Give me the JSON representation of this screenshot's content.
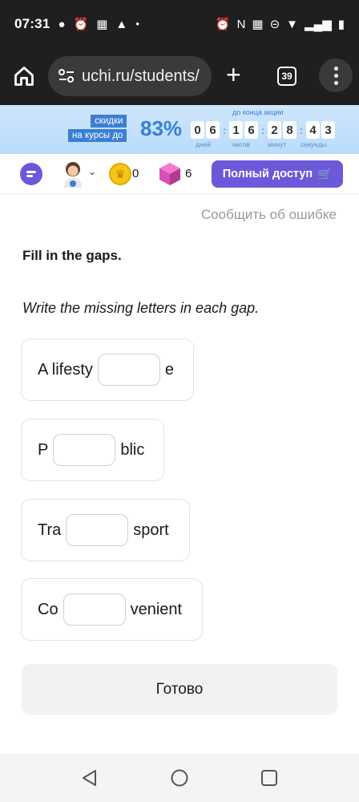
{
  "status_bar": {
    "time": "07:31",
    "left_icons": [
      "chat-bubble-icon",
      "alarm-icon",
      "news-icon",
      "warning-icon",
      "dot-icon"
    ],
    "right_icons": [
      "alarm-icon",
      "nfc-icon",
      "vibrate-icon",
      "dnd-icon",
      "wifi-icon",
      "signal-icon",
      "battery-icon"
    ]
  },
  "browser": {
    "url": "uchi.ru/students/",
    "tab_count": "39"
  },
  "promo": {
    "tag_line1": "скидки",
    "tag_line2": "на курсы до",
    "percent": "83%",
    "until_label": "до конца акции",
    "timer": {
      "days": [
        "0",
        "6"
      ],
      "hours": [
        "1",
        "6"
      ],
      "minutes": [
        "2",
        "8"
      ],
      "seconds": [
        "4",
        "3"
      ]
    },
    "labels": {
      "days": "дней",
      "hours": "часов",
      "minutes": "минут",
      "seconds": "секунды"
    }
  },
  "toolbar": {
    "coins": "0",
    "gems": "6",
    "full_access_label": "Полный доступ",
    "colors": {
      "accent": "#6b59d9",
      "coin": "#f5c518",
      "gem": "#d94fb5"
    }
  },
  "content": {
    "report_error": "Сообщить об ошибке",
    "task_title": "Fill in the gaps.",
    "task_instruction": "Write the missing letters in each gap.",
    "items": [
      {
        "before": "A lifesty",
        "after": "e",
        "value": ""
      },
      {
        "before": "P",
        "after": "blic",
        "value": ""
      },
      {
        "before": "Tra",
        "after": "sport",
        "value": ""
      },
      {
        "before": "Co",
        "after": "venient",
        "value": ""
      }
    ],
    "done_label": "Готово"
  },
  "navbar": {
    "buttons": [
      "back-icon",
      "home-icon",
      "recents-icon"
    ]
  }
}
